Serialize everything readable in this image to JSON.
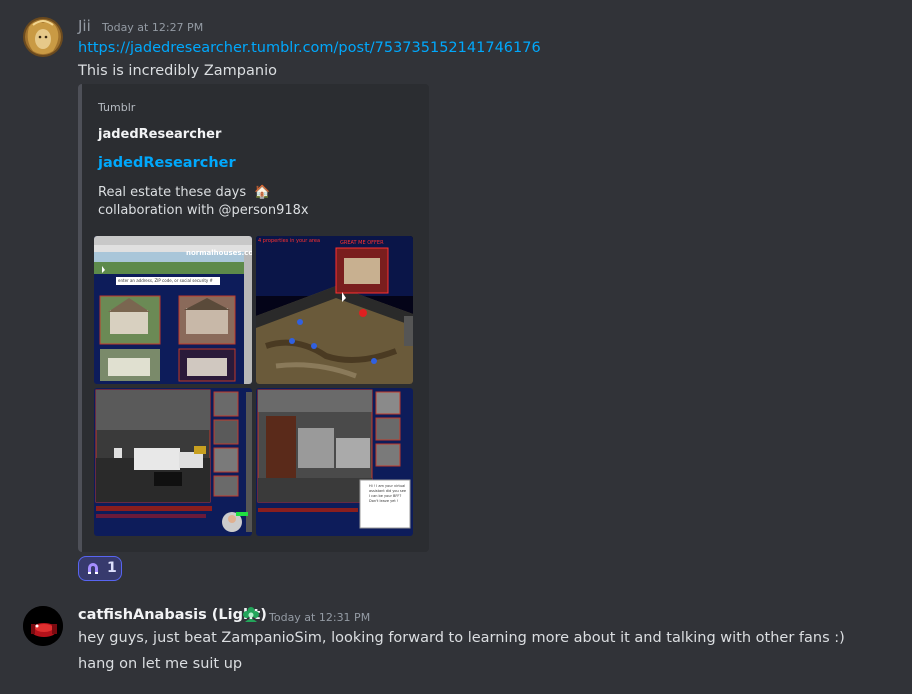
{
  "messages": [
    {
      "username": "Jii",
      "timestamp": "Today at 12:27 PM",
      "link": "https://jadedresearcher.tumblr.com/post/753735152141746176",
      "text": "This is incredibly Zampanio",
      "embed": {
        "provider": "Tumblr",
        "author": "jadedResearcher",
        "title": "jadedResearcher",
        "description_line1": "Real estate these days",
        "description_emoji": "🏠",
        "description_line2": "collaboration with @person918x",
        "images": {
          "site_header": "normalhouses.com",
          "search_placeholder": "enter an address, ZIP code, or social security #",
          "map_banner": "4 properties in your area",
          "map_card_label": "GREAT ME OFFER",
          "chat_popup": "Hi ! I am your virtual assistant did you see I can be your BFF? Don't leave yet !"
        }
      },
      "reaction": {
        "emoji": "horseshoe-magnet",
        "count": "1"
      }
    },
    {
      "username": "catfishAnabasis (Light)",
      "timestamp": "Today at 12:31 PM",
      "lines": [
        "hey guys, just beat ZampanioSim, looking forward to learning more about it and talking with other fans :)",
        "hang on let me suit up"
      ]
    }
  ],
  "colors": {
    "background": "#313338",
    "link": "#00a8fc",
    "embed_bg": "#2b2d31",
    "jii_name": "#949ba4",
    "catfish_name": "#f2f3f5",
    "badge_green": "#23a55a",
    "reaction_bg": "#373a6d",
    "reaction_border": "#5865f2"
  }
}
